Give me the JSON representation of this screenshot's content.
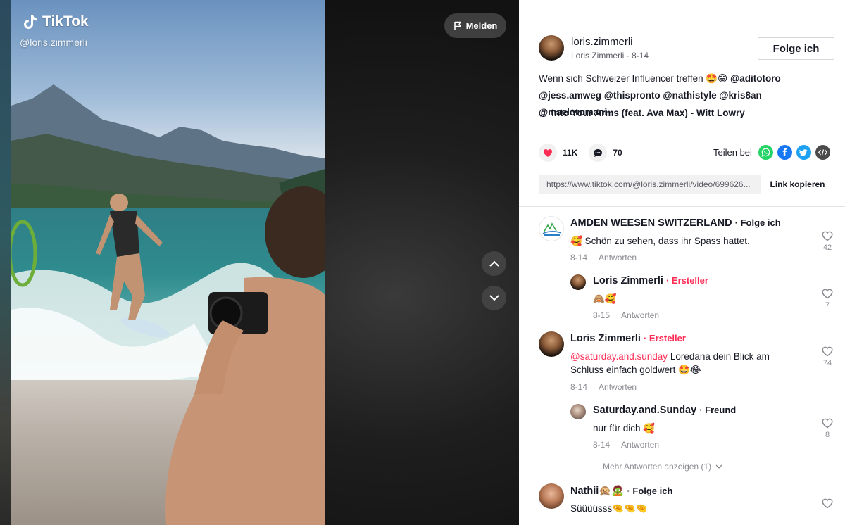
{
  "video": {
    "logo_text": "TikTok",
    "handle": "@loris.zimmerli",
    "report_label": "Melden"
  },
  "author": {
    "username": "loris.zimmerli",
    "display_name": "Loris Zimmerli",
    "date": "8-14",
    "follow_label": "Folge ich"
  },
  "description": {
    "text": "Wenn sich Schweizer Influencer treffen 🤩😁",
    "mentions": [
      "@aditotoro",
      "@jess.amweg",
      "@thispronto",
      "@nathistyle",
      "@kris8an",
      "@maeloromani"
    ]
  },
  "music": {
    "title": "Into Your Arms (feat. Ava Max) - Witt Lowry"
  },
  "stats": {
    "likes": "11K",
    "comments": "70"
  },
  "share": {
    "label": "Teilen bei",
    "icons": [
      "whatsapp-icon",
      "facebook-icon",
      "twitter-icon",
      "embed-icon"
    ],
    "url": "https://www.tiktok.com/@loris.zimmerli/video/699626...",
    "copy_label": "Link kopieren"
  },
  "comments": [
    {
      "name": "AMDEN WEESEN SWITZERLAND",
      "tag": "Folge ich",
      "text": "🥰 Schön zu sehen, dass ihr Spass hattet.",
      "date": "8-14",
      "reply_label": "Antworten",
      "likes": "42",
      "replies": [
        {
          "name": "Loris Zimmerli",
          "tag": "Ersteller",
          "text": "🙈🥰",
          "date": "8-15",
          "reply_label": "Antworten",
          "likes": "7"
        }
      ]
    },
    {
      "name": "Loris Zimmerli",
      "tag": "Ersteller",
      "mention": "@saturday.and.sunday",
      "text": "Loredana dein Blick am Schluss einfach goldwert 🤩😂",
      "date": "8-14",
      "reply_label": "Antworten",
      "likes": "74",
      "replies": [
        {
          "name": "Saturday.and.Sunday",
          "tag": "Freund",
          "text": "nur für dich 🥰",
          "date": "8-14",
          "reply_label": "Antworten",
          "likes": "8"
        }
      ],
      "more_replies": "Mehr Antworten anzeigen (1)"
    },
    {
      "name": "Nathii🙊🧟",
      "tag": "Folge ich",
      "text": "Süüüüsss🤏🤏🤏"
    }
  ],
  "colors": {
    "accent": "#fe2c55",
    "whatsapp": "#25d366",
    "facebook": "#1877f2",
    "twitter": "#1da1f2",
    "embed": "#4a4a4a"
  }
}
